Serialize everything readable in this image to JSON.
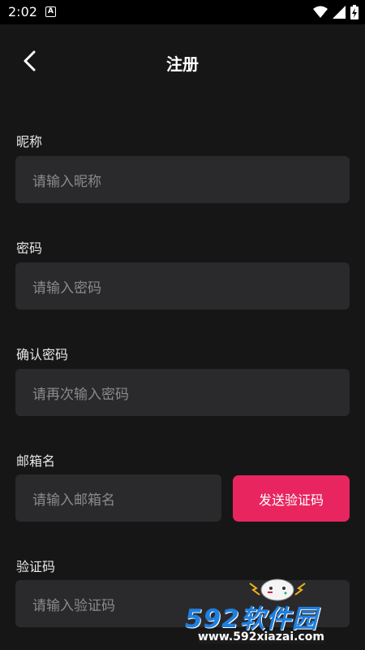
{
  "status_bar": {
    "time": "2:02",
    "notification_letter": "A"
  },
  "header": {
    "title": "注册"
  },
  "form": {
    "nickname": {
      "label": "昵称",
      "placeholder": "请输入昵称"
    },
    "password": {
      "label": "密码",
      "placeholder": "请输入密码"
    },
    "confirm_password": {
      "label": "确认密码",
      "placeholder": "请再次输入密码"
    },
    "email": {
      "label": "邮箱名",
      "placeholder": "请输入邮箱名"
    },
    "send_code_label": "发送验证码",
    "code": {
      "label": "验证码",
      "placeholder": "请输入验证码"
    }
  },
  "watermark": {
    "brand": "592软件园",
    "url": "www.592xiazai.com"
  },
  "colors": {
    "background": "#161616",
    "input_bg": "#2a2a2c",
    "accent": "#e8255f",
    "watermark_blue": "#1e7fe0"
  }
}
